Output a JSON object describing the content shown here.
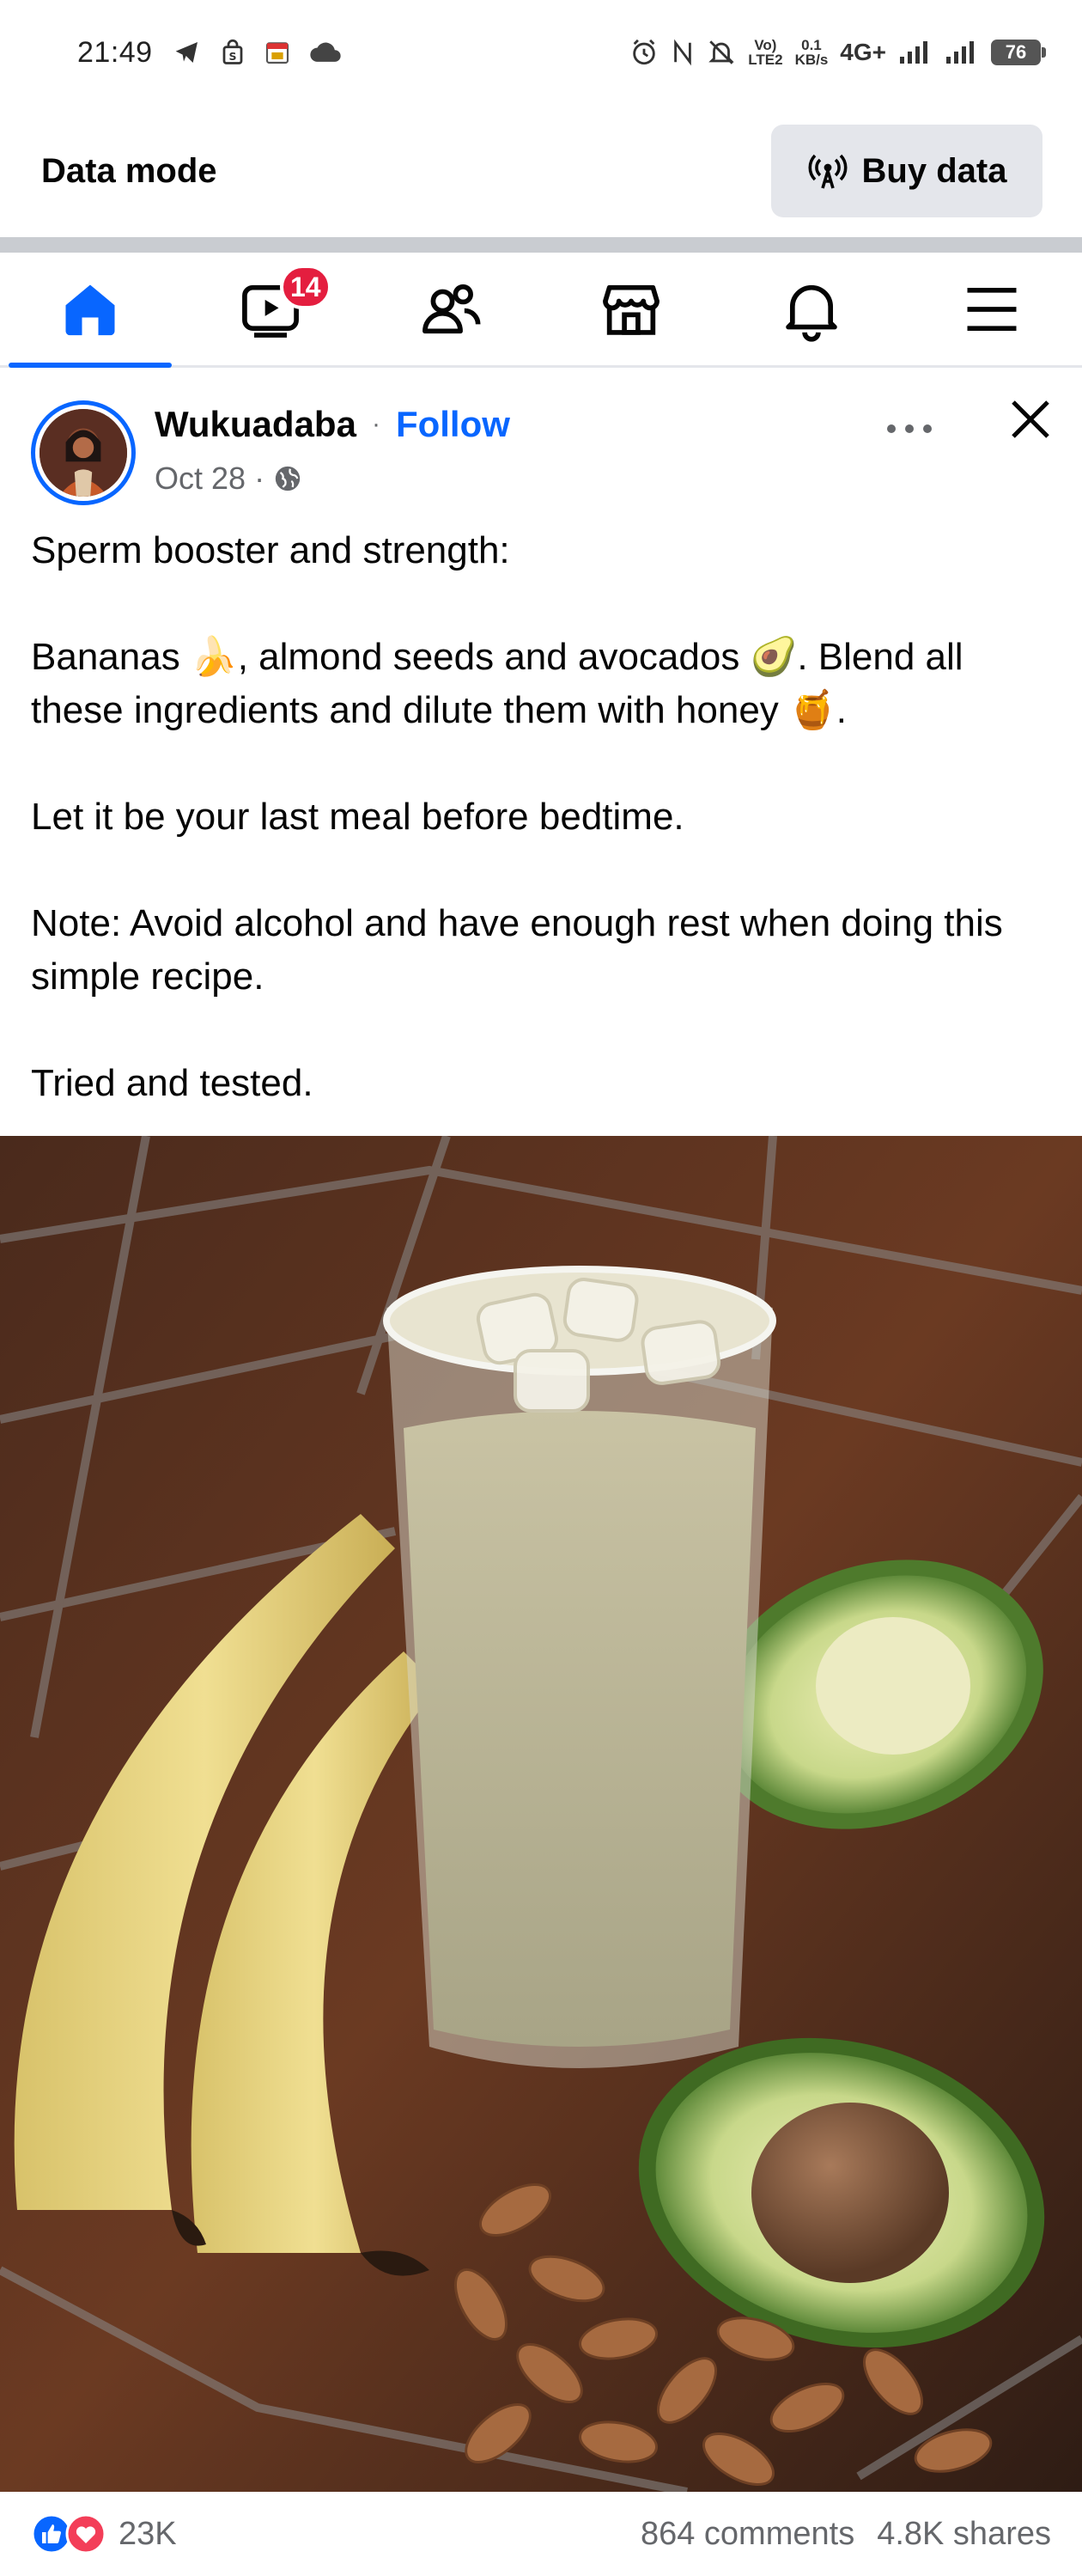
{
  "status_bar": {
    "time": "21:49",
    "volte": "Vo)\nLTE2",
    "speed_value": "0.1",
    "speed_unit": "KB/s",
    "network": "4G+",
    "battery": "76"
  },
  "data_mode": {
    "title": "Data mode",
    "buy_label": "Buy data"
  },
  "nav": {
    "video_badge": "14",
    "tabs": [
      "home-icon",
      "video-icon",
      "friends-icon",
      "marketplace-icon",
      "notifications-icon",
      "menu-icon"
    ]
  },
  "post": {
    "author": "Wukuadaba",
    "separator": "·",
    "follow_label": "Follow",
    "date": "Oct 28",
    "meta_separator": "·",
    "lines": {
      "l1": "Sperm booster and strength:",
      "l2": "Bananas 🍌, almond seeds and avocados 🥑. Blend all these ingredients and dilute them with honey 🍯.",
      "l3": "Let it be your last meal before bedtime.",
      "l4": "Note: Avoid alcohol and have enough rest when doing this simple recipe.",
      "l5": "Tried and tested."
    }
  },
  "reactions": {
    "count": "23K",
    "comments": "864 comments",
    "shares": "4.8K shares"
  },
  "colors": {
    "accent": "#0866ff",
    "badge": "#e41e3f",
    "secondary_text": "#65676b"
  }
}
